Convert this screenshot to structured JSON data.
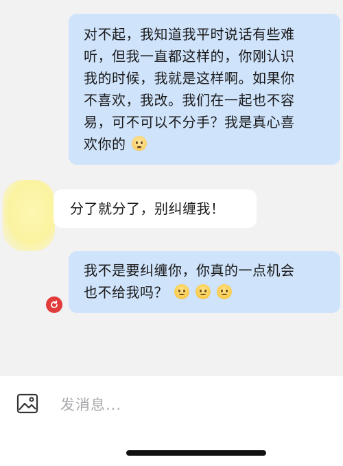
{
  "messages": [
    {
      "direction": "outgoing",
      "lines": [
        "对不起，我知道我平时说话有些难",
        "听，但我一直都这样的，你刚认识",
        "我的时候，我就是这样啊。如果你",
        "不喜欢，我改。我们在一起也不容",
        "易，可不可以不分手？我是真心喜",
        "欢你的"
      ],
      "emoji": [
        "flushed-face"
      ]
    },
    {
      "direction": "incoming",
      "lines": [
        "分了就分了，别纠缠我！"
      ]
    },
    {
      "direction": "outgoing",
      "lines": [
        "我不是要纠缠你，你真的一点机会",
        "也不给我吗？"
      ],
      "emoji": [
        "frowning-face",
        "frowning-face",
        "frowning-face"
      ],
      "status": "failed"
    }
  ],
  "input": {
    "placeholder": "发消息..."
  },
  "colors": {
    "outgoing_bubble": "#cfe3fb",
    "incoming_bubble": "#ffffff",
    "chat_background": "#f2f2f3",
    "retry_red": "#e23b3b"
  },
  "icons": [
    "image-icon",
    "retry-icon"
  ]
}
